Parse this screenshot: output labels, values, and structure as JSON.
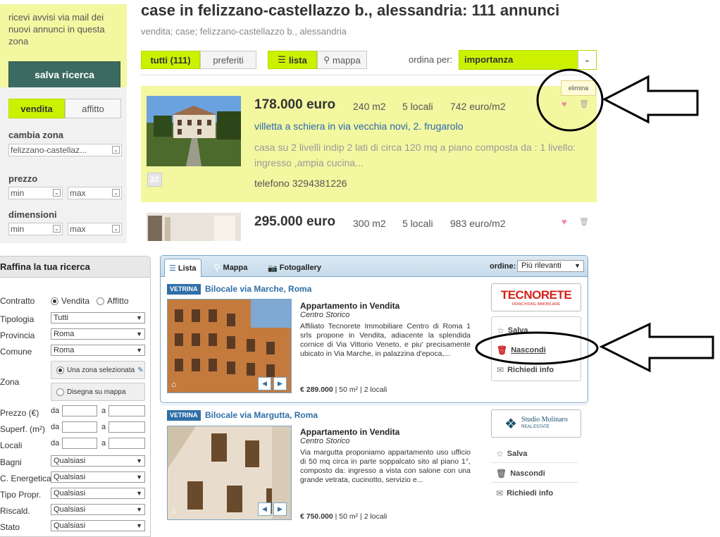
{
  "top": {
    "alert": {
      "text": "ricevi avvisi via mail dei nuovi annunci in questa zona",
      "button": "salva ricerca"
    },
    "mode_tabs": [
      "vendita",
      "affitto"
    ],
    "zone": {
      "label": "cambia zona",
      "value": "felizzano-castellaz..."
    },
    "price": {
      "label": "prezzo",
      "min": "min",
      "max": "max"
    },
    "size": {
      "label": "dimensioni",
      "min": "min",
      "max": "max"
    },
    "heading": "case in felizzano-castellazzo b., alessandria: 111 annunci",
    "breadcrumbs": "vendita; case; felizzano-castellazzo b., alessandria",
    "filter_tabs": {
      "all": "tutti (111)",
      "favorites": "preferiti"
    },
    "view_tabs": {
      "list": "lista",
      "map": "mappa"
    },
    "sort": {
      "label": "ordina per:",
      "value": "importanza"
    },
    "listing1": {
      "price": "178.000 euro",
      "area": "240 m2",
      "rooms": "5 locali",
      "ppm": "742 euro/m2",
      "title": "villetta a schiera in via vecchia novi, 2. frugarolo",
      "desc": "casa su 2 livelli indip 2 lati di circa 120 mq a piano composta da : 1 livello: ingresso ,ampia cucina...",
      "phone": "telefono 3294381226",
      "photo_count": "22",
      "tooltip": "elimina"
    },
    "listing2": {
      "price": "295.000 euro",
      "area": "300 m2",
      "rooms": "5 locali",
      "ppm": "983 euro/m2"
    }
  },
  "bottom": {
    "refine": {
      "title": "Raffina la tua ricerca",
      "contratto": {
        "label": "Contratto",
        "opt1": "Vendita",
        "opt2": "Affitto"
      },
      "tipologia": {
        "label": "Tipologia",
        "value": "Tutti"
      },
      "provincia": {
        "label": "Provincia",
        "value": "Roma"
      },
      "comune": {
        "label": "Comune",
        "value": "Roma"
      },
      "zona": {
        "label": "Zona",
        "btn1": "Una zona selezionata",
        "btn2": "Disegna su mappa"
      },
      "prezzo": {
        "label": "Prezzo (€)",
        "da": "da",
        "a": "a"
      },
      "superf": {
        "label": "Superf. (m²)",
        "da": "da",
        "a": "a"
      },
      "locali": {
        "label": "Locali",
        "da": "da",
        "a": "a"
      },
      "bagni": {
        "label": "Bagni",
        "value": "Qualsiasi"
      },
      "energetica": {
        "label": "C. Energetica",
        "value": "Qualsiasi"
      },
      "tipo_propr": {
        "label": "Tipo Propr.",
        "value": "Qualsiasi"
      },
      "riscald": {
        "label": "Riscald.",
        "value": "Qualsiasi"
      },
      "stato": {
        "label": "Stato",
        "value": "Qualsiasi"
      }
    },
    "tabs": {
      "list": "Lista",
      "map": "Mappa",
      "gallery": "Fotogallery"
    },
    "order": {
      "label": "ordine:",
      "value": "Più rilevanti"
    },
    "result1": {
      "badge": "VETRINA",
      "title": "Bilocale via Marche, Roma",
      "heading": "Appartamento in Vendita",
      "subheading": "Centro Storico",
      "desc": "Affiliato Tecnorete Immobiliare Centro di Roma 1 srls propone in Vendita, adiacente la splendida cornice di Via Vittorio Veneto, e piu' precisamente ubicato in Via Marche, in palazzina d'epoca,...",
      "price": "€ 289.000",
      "area": "50 m²",
      "rooms": "2 locali",
      "agency": "TECNORETE",
      "agency_tagline": "FRANCHISING IMMOBILIARE",
      "save": "Salva",
      "hide": "Nascondi",
      "info": "Richiedi info"
    },
    "result2": {
      "badge": "VETRINA",
      "title": "Bilocale via Margutta, Roma",
      "heading": "Appartamento in Vendita",
      "subheading": "Centro Storico",
      "desc": "Via margutta proponiamo appartamento uso ufficio di 50 mq circa in parte soppalcato sito al piano 1°, composto da: ingresso a vista con salone con una grande vetrata, cucinotto, servizio e...",
      "price": "€ 750.000",
      "area": "50 m²",
      "rooms": "2 locali",
      "agency": "Studio Molinaro",
      "agency_tagline": "REAL ESTATE",
      "save": "Salva",
      "hide": "Nascondi",
      "info": "Richiedi info"
    }
  }
}
